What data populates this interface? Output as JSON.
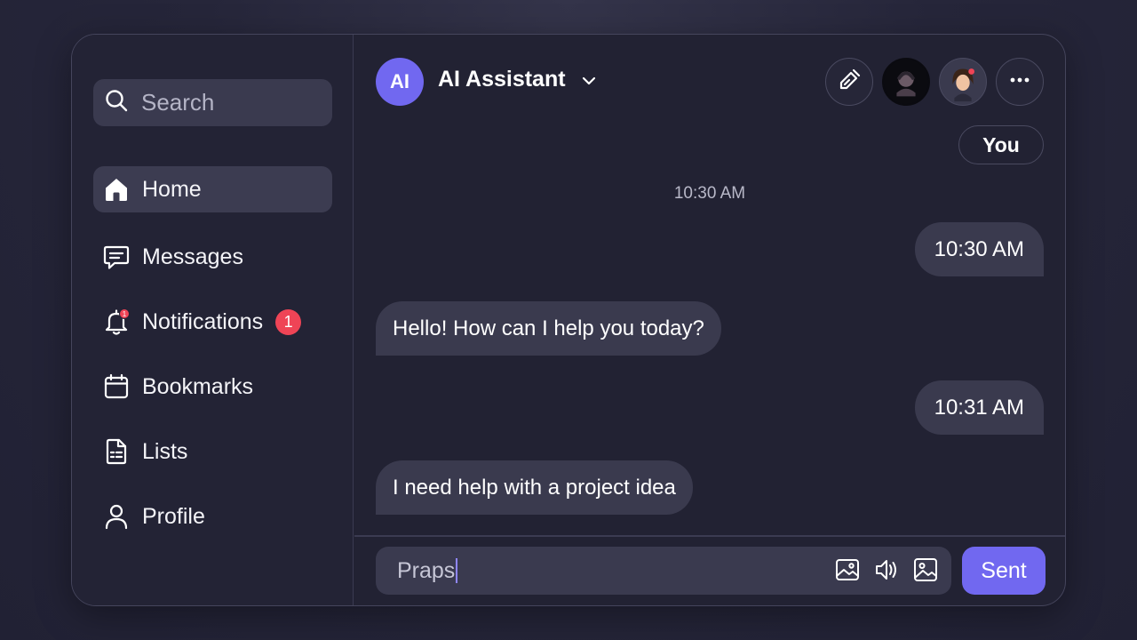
{
  "colors": {
    "accent": "#7168f0",
    "badge": "#ef4456",
    "bubble": "#3a3a4e",
    "panel": "#222233"
  },
  "sidebar": {
    "search_placeholder": "Search",
    "items": [
      {
        "label": "Home",
        "icon": "home-icon",
        "active": true
      },
      {
        "label": "Messages",
        "icon": "message-icon"
      },
      {
        "label": "Notifications",
        "icon": "bell-icon",
        "badge": "1",
        "icon_badge": "1"
      },
      {
        "label": "Bookmarks",
        "icon": "calendar-icon"
      },
      {
        "label": "Lists",
        "icon": "list-document-icon"
      },
      {
        "label": "Profile",
        "icon": "user-icon"
      }
    ]
  },
  "chat": {
    "avatar_initials": "AI",
    "title": "AI Assistant",
    "header_actions": [
      "edit-icon",
      "avatar-dark",
      "avatar-woman",
      "more-icon"
    ],
    "you_label": "You",
    "timestamp": "10:30 AM",
    "messages": [
      {
        "side": "right",
        "text": "10:30 AM"
      },
      {
        "side": "left",
        "text": "Hello! How can I help you today?"
      },
      {
        "side": "right",
        "text": "10:31 AM"
      },
      {
        "side": "left",
        "text": "I need help with a project idea"
      }
    ]
  },
  "composer": {
    "value": "Praps",
    "tools": [
      "image-icon",
      "speaker-icon",
      "image-icon"
    ],
    "send_label": "Sent"
  }
}
